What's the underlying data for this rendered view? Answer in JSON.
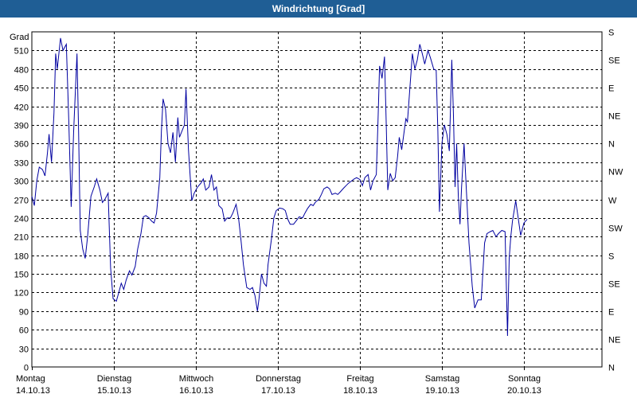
{
  "window": {
    "title": "Windrichtung [Grad]"
  },
  "chart_data": {
    "type": "line",
    "title": "Windrichtung [Grad]",
    "ylabel": "Grad",
    "ylim": [
      0,
      540
    ],
    "grid": true,
    "y_ticks": [
      0,
      30,
      60,
      90,
      120,
      150,
      180,
      210,
      240,
      270,
      300,
      330,
      360,
      390,
      420,
      450,
      480,
      510
    ],
    "right_axis_labels": [
      "N",
      "NE",
      "E",
      "SE",
      "S",
      "SW",
      "W",
      "NW",
      "N",
      "NE",
      "E",
      "SE",
      "S"
    ],
    "x_range": [
      0,
      7
    ],
    "x_ticks": [
      {
        "day": "Montag",
        "date": "14.10.13"
      },
      {
        "day": "Dienstag",
        "date": "15.10.13"
      },
      {
        "day": "Mittwoch",
        "date": "16.10.13"
      },
      {
        "day": "Donnerstag",
        "date": "17.10.13"
      },
      {
        "day": "Freitag",
        "date": "18.10.13"
      },
      {
        "day": "Samstag",
        "date": "19.10.13"
      },
      {
        "day": "Sonntag",
        "date": "20.10.13"
      }
    ],
    "series": [
      {
        "color": "#0000a0",
        "points": [
          [
            0.0,
            275
          ],
          [
            0.03,
            260
          ],
          [
            0.06,
            300
          ],
          [
            0.09,
            322
          ],
          [
            0.13,
            318
          ],
          [
            0.16,
            308
          ],
          [
            0.19,
            345
          ],
          [
            0.21,
            375
          ],
          [
            0.24,
            330
          ],
          [
            0.27,
            410
          ],
          [
            0.29,
            505
          ],
          [
            0.31,
            480
          ],
          [
            0.35,
            530
          ],
          [
            0.38,
            510
          ],
          [
            0.42,
            520
          ],
          [
            0.45,
            400
          ],
          [
            0.48,
            258
          ],
          [
            0.51,
            380
          ],
          [
            0.55,
            505
          ],
          [
            0.57,
            380
          ],
          [
            0.59,
            220
          ],
          [
            0.62,
            190
          ],
          [
            0.65,
            175
          ],
          [
            0.68,
            210
          ],
          [
            0.72,
            275
          ],
          [
            0.76,
            290
          ],
          [
            0.79,
            303
          ],
          [
            0.83,
            285
          ],
          [
            0.86,
            265
          ],
          [
            0.89,
            270
          ],
          [
            0.93,
            280
          ],
          [
            0.96,
            160
          ],
          [
            0.99,
            110
          ],
          [
            1.03,
            106
          ],
          [
            1.06,
            120
          ],
          [
            1.09,
            135
          ],
          [
            1.12,
            125
          ],
          [
            1.15,
            140
          ],
          [
            1.19,
            155
          ],
          [
            1.22,
            148
          ],
          [
            1.26,
            162
          ],
          [
            1.29,
            190
          ],
          [
            1.33,
            215
          ],
          [
            1.36,
            242
          ],
          [
            1.39,
            244
          ],
          [
            1.43,
            240
          ],
          [
            1.46,
            235
          ],
          [
            1.49,
            232
          ],
          [
            1.52,
            248
          ],
          [
            1.56,
            305
          ],
          [
            1.58,
            380
          ],
          [
            1.6,
            432
          ],
          [
            1.63,
            415
          ],
          [
            1.66,
            360
          ],
          [
            1.69,
            345
          ],
          [
            1.72,
            378
          ],
          [
            1.75,
            330
          ],
          [
            1.78,
            402
          ],
          [
            1.8,
            370
          ],
          [
            1.83,
            380
          ],
          [
            1.86,
            390
          ],
          [
            1.88,
            448
          ],
          [
            1.91,
            350
          ],
          [
            1.95,
            268
          ],
          [
            1.98,
            280
          ],
          [
            2.02,
            290
          ],
          [
            2.06,
            296
          ],
          [
            2.09,
            303
          ],
          [
            2.12,
            285
          ],
          [
            2.16,
            290
          ],
          [
            2.19,
            310
          ],
          [
            2.22,
            285
          ],
          [
            2.25,
            290
          ],
          [
            2.28,
            260
          ],
          [
            2.32,
            255
          ],
          [
            2.35,
            235
          ],
          [
            2.38,
            240
          ],
          [
            2.42,
            240
          ],
          [
            2.45,
            248
          ],
          [
            2.49,
            262
          ],
          [
            2.52,
            240
          ],
          [
            2.55,
            205
          ],
          [
            2.58,
            165
          ],
          [
            2.62,
            128
          ],
          [
            2.66,
            125
          ],
          [
            2.69,
            128
          ],
          [
            2.72,
            115
          ],
          [
            2.75,
            90
          ],
          [
            2.77,
            110
          ],
          [
            2.8,
            150
          ],
          [
            2.83,
            135
          ],
          [
            2.86,
            130
          ],
          [
            2.88,
            165
          ],
          [
            2.92,
            205
          ],
          [
            2.95,
            240
          ],
          [
            2.98,
            252
          ],
          [
            3.02,
            256
          ],
          [
            3.06,
            255
          ],
          [
            3.09,
            252
          ],
          [
            3.12,
            238
          ],
          [
            3.15,
            230
          ],
          [
            3.19,
            230
          ],
          [
            3.22,
            235
          ],
          [
            3.26,
            242
          ],
          [
            3.3,
            240
          ],
          [
            3.33,
            248
          ],
          [
            3.36,
            255
          ],
          [
            3.4,
            262
          ],
          [
            3.43,
            260
          ],
          [
            3.46,
            266
          ],
          [
            3.5,
            270
          ],
          [
            3.53,
            278
          ],
          [
            3.56,
            287
          ],
          [
            3.6,
            290
          ],
          [
            3.63,
            287
          ],
          [
            3.66,
            278
          ],
          [
            3.7,
            280
          ],
          [
            3.73,
            278
          ],
          [
            3.76,
            282
          ],
          [
            3.8,
            288
          ],
          [
            3.83,
            292
          ],
          [
            3.86,
            296
          ],
          [
            3.9,
            300
          ],
          [
            3.93,
            303
          ],
          [
            3.96,
            305
          ],
          [
            4.0,
            302
          ],
          [
            4.03,
            292
          ],
          [
            4.06,
            305
          ],
          [
            4.1,
            310
          ],
          [
            4.13,
            285
          ],
          [
            4.16,
            300
          ],
          [
            4.2,
            310
          ],
          [
            4.22,
            395
          ],
          [
            4.24,
            485
          ],
          [
            4.27,
            465
          ],
          [
            4.3,
            500
          ],
          [
            4.32,
            395
          ],
          [
            4.34,
            285
          ],
          [
            4.37,
            312
          ],
          [
            4.4,
            300
          ],
          [
            4.43,
            305
          ],
          [
            4.46,
            340
          ],
          [
            4.48,
            370
          ],
          [
            4.51,
            350
          ],
          [
            4.53,
            370
          ],
          [
            4.56,
            400
          ],
          [
            4.58,
            395
          ],
          [
            4.61,
            450
          ],
          [
            4.64,
            505
          ],
          [
            4.67,
            480
          ],
          [
            4.7,
            495
          ],
          [
            4.73,
            520
          ],
          [
            4.76,
            505
          ],
          [
            4.79,
            488
          ],
          [
            4.83,
            510
          ],
          [
            4.86,
            498
          ],
          [
            4.9,
            480
          ],
          [
            4.93,
            478
          ],
          [
            4.95,
            380
          ],
          [
            4.97,
            250
          ],
          [
            5.0,
            360
          ],
          [
            5.03,
            390
          ],
          [
            5.06,
            375
          ],
          [
            5.09,
            348
          ],
          [
            5.12,
            495
          ],
          [
            5.14,
            410
          ],
          [
            5.16,
            290
          ],
          [
            5.18,
            360
          ],
          [
            5.2,
            275
          ],
          [
            5.22,
            230
          ],
          [
            5.24,
            290
          ],
          [
            5.27,
            360
          ],
          [
            5.3,
            280
          ],
          [
            5.33,
            200
          ],
          [
            5.37,
            130
          ],
          [
            5.4,
            95
          ],
          [
            5.44,
            108
          ],
          [
            5.48,
            108
          ],
          [
            5.52,
            200
          ],
          [
            5.55,
            215
          ],
          [
            5.59,
            218
          ],
          [
            5.62,
            220
          ],
          [
            5.66,
            210
          ],
          [
            5.69,
            215
          ],
          [
            5.73,
            220
          ],
          [
            5.77,
            218
          ],
          [
            5.8,
            50
          ],
          [
            5.82,
            175
          ],
          [
            5.84,
            210
          ],
          [
            5.86,
            235
          ],
          [
            5.9,
            268
          ],
          [
            5.93,
            240
          ],
          [
            5.96,
            212
          ],
          [
            6.0,
            232
          ],
          [
            6.04,
            238
          ]
        ]
      }
    ]
  }
}
